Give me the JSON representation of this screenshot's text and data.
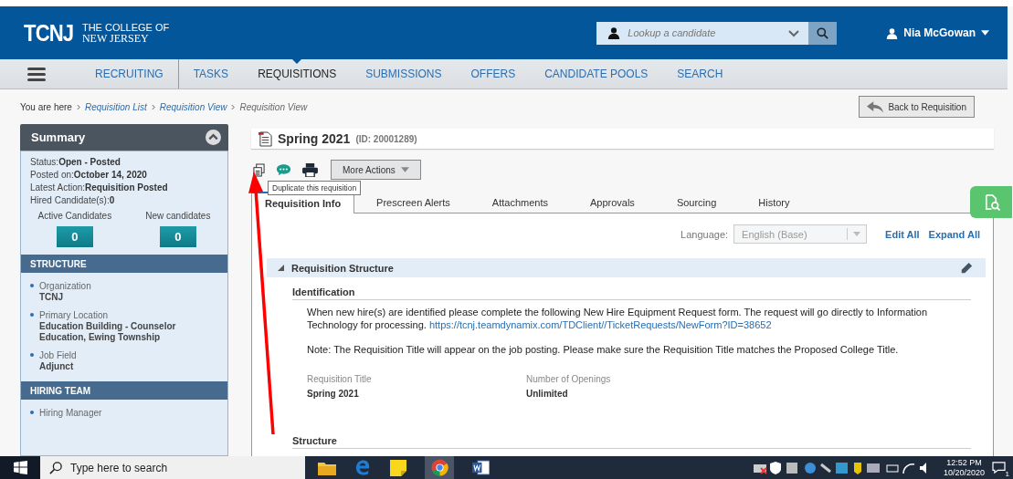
{
  "header": {
    "logo": {
      "abbr": "TCNJ",
      "line1": "THE COLLEGE OF",
      "line2": "NEW JERSEY"
    },
    "search": {
      "placeholder": "Lookup a candidate"
    },
    "user": "Nia McGowan"
  },
  "nav": [
    {
      "label": "RECRUITING",
      "selected": false
    },
    {
      "label": "TASKS",
      "selected": false
    },
    {
      "label": "REQUISITIONS",
      "selected": true
    },
    {
      "label": "SUBMISSIONS",
      "selected": false
    },
    {
      "label": "OFFERS",
      "selected": false
    },
    {
      "label": "CANDIDATE POOLS",
      "selected": false
    },
    {
      "label": "SEARCH",
      "selected": false
    }
  ],
  "breadcrumb": {
    "lead": "You are here",
    "items": [
      {
        "label": "Requisition List",
        "kind": "link"
      },
      {
        "label": "Requisition View",
        "kind": "link"
      },
      {
        "label": "Requisition View",
        "kind": "current"
      }
    ]
  },
  "back_button": "Back to Requisition",
  "summary": {
    "title": "Summary",
    "status": [
      {
        "label": "Status:",
        "value": "Open - Posted"
      },
      {
        "label": "Posted on:",
        "value": "October 14, 2020"
      },
      {
        "label": "Latest Action:",
        "value": "Requisition Posted"
      },
      {
        "label": "Hired Candidate(s):",
        "value": "0"
      }
    ],
    "counters": [
      {
        "label": "Active Candidates",
        "value": "0"
      },
      {
        "label": "New candidates",
        "value": "0"
      }
    ],
    "sections": [
      {
        "title": "STRUCTURE",
        "items": [
          {
            "label": "Organization",
            "value": "TCNJ"
          },
          {
            "label": "Primary Location",
            "value": "Education Building - Counselor Education, Ewing Township"
          },
          {
            "label": "Job Field",
            "value": "Adjunct"
          }
        ]
      },
      {
        "title": "HIRING TEAM",
        "items": [
          {
            "label": "Hiring Manager"
          }
        ]
      }
    ]
  },
  "requisition": {
    "title": "Spring 2021",
    "id": "(ID: 20001289)",
    "more_actions": "More Actions",
    "tooltip": "Duplicate this requisition",
    "tabs": [
      {
        "label": "Requisition Info",
        "selected": true
      },
      {
        "label": "Prescreen Alerts",
        "selected": false
      },
      {
        "label": "Attachments",
        "selected": false
      },
      {
        "label": "Approvals",
        "selected": false
      },
      {
        "label": "Sourcing",
        "selected": false
      },
      {
        "label": "History",
        "selected": false
      }
    ],
    "language": {
      "label": "Language:",
      "value": "English (Base)"
    },
    "links": [
      "Edit All",
      "Expand All"
    ],
    "section": "Requisition Structure",
    "identification": "Identification",
    "paragraph": "When new hire(s) are identified please complete the following New Hire Equipment Request form. The request will go directly to Information Technology for processing.",
    "link": "https://tcnj.teamdynamix.com/TDClient//TicketRequests/NewForm?ID=38652",
    "note": "Note: The Requisition Title will appear on the job posting. Please make sure the Requisition Title matches the Proposed College Title.",
    "fields": [
      {
        "label": "Requisition Title",
        "value": "Spring 2021"
      },
      {
        "label": "Number of Openings",
        "value": "Unlimited"
      }
    ],
    "structure": "Structure"
  },
  "taskbar": {
    "search": "Type here to search",
    "time": "12:52 PM",
    "date": "10/20/2020",
    "notifications": "1"
  }
}
